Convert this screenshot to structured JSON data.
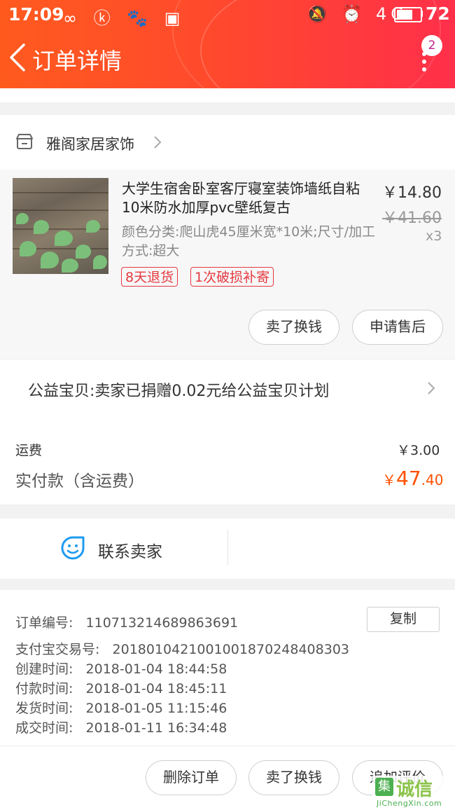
{
  "status_bar": {
    "time": "17:09",
    "left_icons": "∞ ⓚ 🐾 ▣",
    "right_icons": "🔕 ⏰ 4G",
    "battery": "72",
    "battery_level": 0.72
  },
  "header": {
    "title": "订单详情",
    "badge_count": "2"
  },
  "shop": {
    "name": "雅阁家居家饰"
  },
  "product": {
    "title": "大学生宿舍卧室客厅寝室装饰墙纸自粘10米防水加厚pvc壁纸复古",
    "spec": "颜色分类:爬山虎45厘米宽*10米;尺寸/加工方式:超大",
    "price": "￥14.80",
    "original_price": "￥41.60",
    "quantity": "x3",
    "tags": [
      "8天退货",
      "1次破损补寄"
    ],
    "actions": [
      "卖了换钱",
      "申请售后"
    ]
  },
  "charity": {
    "text": "公益宝贝:卖家已捐赠0.02元给公益宝贝计划"
  },
  "fees": {
    "shipping_label": "运费",
    "shipping_value": "￥3.00",
    "paid_label": "实付款（含运费）",
    "paid_currency": "￥",
    "paid_int": "47",
    "paid_dec": ".40"
  },
  "contact": {
    "label": "联系卖家"
  },
  "order_info": {
    "order_no_label": "订单编号:",
    "order_no": "110713214689863691",
    "copy_label": "复制",
    "lines": [
      "支付宝交易号:   2018010421001001870248408303",
      "创建时间:   2018-01-04 18:44:58",
      "付款时间:   2018-01-04 18:45:11",
      "发货时间:   2018-01-05 11:15:46",
      "成交时间:   2018-01-11 16:34:48"
    ]
  },
  "bottom_actions": {
    "delete": "删除订单",
    "sell": "卖了换钱",
    "review": "追加评价"
  },
  "watermark": {
    "logo": "集",
    "text": "诚信",
    "sub": "JiChengXin.com"
  },
  "colors": {
    "header_start": "#ff5a1e",
    "header_end": "#ff2f4a",
    "price_accent": "#ff5000",
    "tag_red": "#e5393f",
    "contact_blue": "#1e9bf0"
  }
}
